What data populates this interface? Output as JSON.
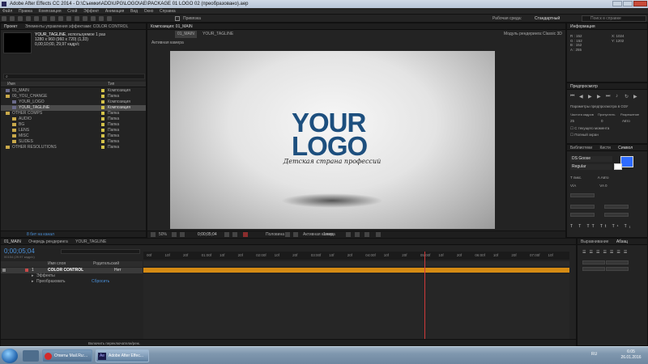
{
  "app": {
    "title": "Adobe After Effects CC 2014 - D:\\Съемки\\ADD\\UPG\\LOGO\\AE\\PACKAGE 01 LOGO 02 (преобразовано).aep"
  },
  "menu": [
    "Файл",
    "Правка",
    "Композиция",
    "Слой",
    "Эффект",
    "Анимация",
    "Вид",
    "Окно",
    "Справка"
  ],
  "toolbar": {
    "snap_label": "Привязка",
    "workspace_label": "Рабочая среда:",
    "workspace_value": "Стандартный",
    "help_placeholder": "Поиск в справке"
  },
  "project": {
    "tab": "Проект",
    "effects_tab": "Элементы управления эффектами: COLOR CONTROL",
    "selected_name": "YOUR_TAGLINE",
    "selected_usage": ", используемое 1 раз",
    "info1": "1280 x 960  (960 x 720) (1,33)",
    "info2": "0,00;10;00, 29,97 кадр/с",
    "col_name": "Имя",
    "col_type": "Тип",
    "search_placeholder": "",
    "items": [
      {
        "name": "01_MAIN",
        "type": "Композиция",
        "indent": 0
      },
      {
        "name": "00_YOU_CHANGE",
        "type": "Папка",
        "indent": 0
      },
      {
        "name": "YOUR_LOGO",
        "type": "Композиция",
        "indent": 1
      },
      {
        "name": "YOUR_TAGLINE",
        "type": "Композиция",
        "indent": 1,
        "selected": true
      },
      {
        "name": "OTHER COMPS",
        "type": "Папка",
        "indent": 0
      },
      {
        "name": "AUDIO",
        "type": "Папка",
        "indent": 1
      },
      {
        "name": "BG",
        "type": "Папка",
        "indent": 1
      },
      {
        "name": "LENS",
        "type": "Папка",
        "indent": 1
      },
      {
        "name": "MISC",
        "type": "Папка",
        "indent": 1
      },
      {
        "name": "SLIDES",
        "type": "Папка",
        "indent": 1
      },
      {
        "name": "OTHER RESOLUTIONS",
        "type": "Папка",
        "indent": 0
      }
    ],
    "bpc": "8 бит на канал"
  },
  "comp": {
    "tab": "Композиция: 01_MAIN",
    "breadcrumb": [
      "01_MAIN",
      "YOUR_TAGLINE"
    ],
    "renderer_label": "Модуль рендеринга:",
    "renderer_value": "Classic 3D",
    "active_camera": "Активная камера",
    "logo_line1": "YOUR",
    "logo_line2": "LOGO",
    "tagline": "Детская страна профессий",
    "zoom": "50%",
    "timecode": "0;00;05;04",
    "resolution": "Половина",
    "view": "Активная камера",
    "views": "1 вид",
    "colors": {
      "logo": "#1d4f7e",
      "bg_center": "#f7f7f7",
      "bg_edge": "#9a9a9a"
    }
  },
  "info": {
    "tab": "Информация",
    "r": "R :",
    "g": "G :",
    "b": "B :",
    "a": "A :",
    "r_val": "152",
    "g_val": "152",
    "b_val": "152",
    "a_val": "255",
    "x": "X: 1024",
    "y": "Y: 1202"
  },
  "preview": {
    "tab": "Предпросмотр",
    "settings": "Параметры предпросмотра в ОЗУ",
    "fps_label": "Частота кадров",
    "skip_label": "Пропустить",
    "res_label": "Разрешение",
    "fps": "25",
    "skip": "0",
    "res": "Авто",
    "from_current": "С текущего момента",
    "fullscreen": "Полный экран"
  },
  "char_panel": {
    "tabs": [
      "Библиотеки",
      "Кисти",
      "Символ"
    ],
    "font": "DS Goose",
    "style": "Regular",
    "size": "пикс.",
    "leading": "Авто",
    "tracking": "0",
    "swatch": "#2f6cff"
  },
  "paragraph": {
    "tabs": [
      "Выравнивание",
      "Абзац"
    ]
  },
  "timeline": {
    "tabs": [
      "01_MAIN",
      "Очередь рендеринга",
      "YOUR_TAGLINE"
    ],
    "timecode": "0;00;05;04",
    "frame_info": "00154 (29.97 кадр/с)",
    "col_name": "Имя слоя",
    "col_parent": "Родительский",
    "ticks": [
      "00f",
      "10f",
      "20f",
      "01:00f",
      "10f",
      "20f",
      "02:00f",
      "10f",
      "20f",
      "03:00f",
      "10f",
      "20f",
      "04:00f",
      "10f",
      "20f",
      "05:00f",
      "10f",
      "20f",
      "06:00f",
      "10f",
      "20f",
      "07:00f",
      "10f"
    ],
    "layers": [
      {
        "num": "1",
        "name": "COLOR CONTROL",
        "parent": "Нет"
      }
    ],
    "sub": [
      {
        "name": "Эффекты",
        "value": ""
      },
      {
        "name": "Преобразовать",
        "value": "Сбросить"
      }
    ],
    "footer": "Включить переключатели/реж.",
    "playhead_fraction": 0.66
  },
  "taskbar": {
    "items": [
      "Ответы Mail.Ru:...",
      "Adobe After Effec..."
    ],
    "lang": "RU",
    "time": "6:05",
    "date": "26.01.2016"
  }
}
